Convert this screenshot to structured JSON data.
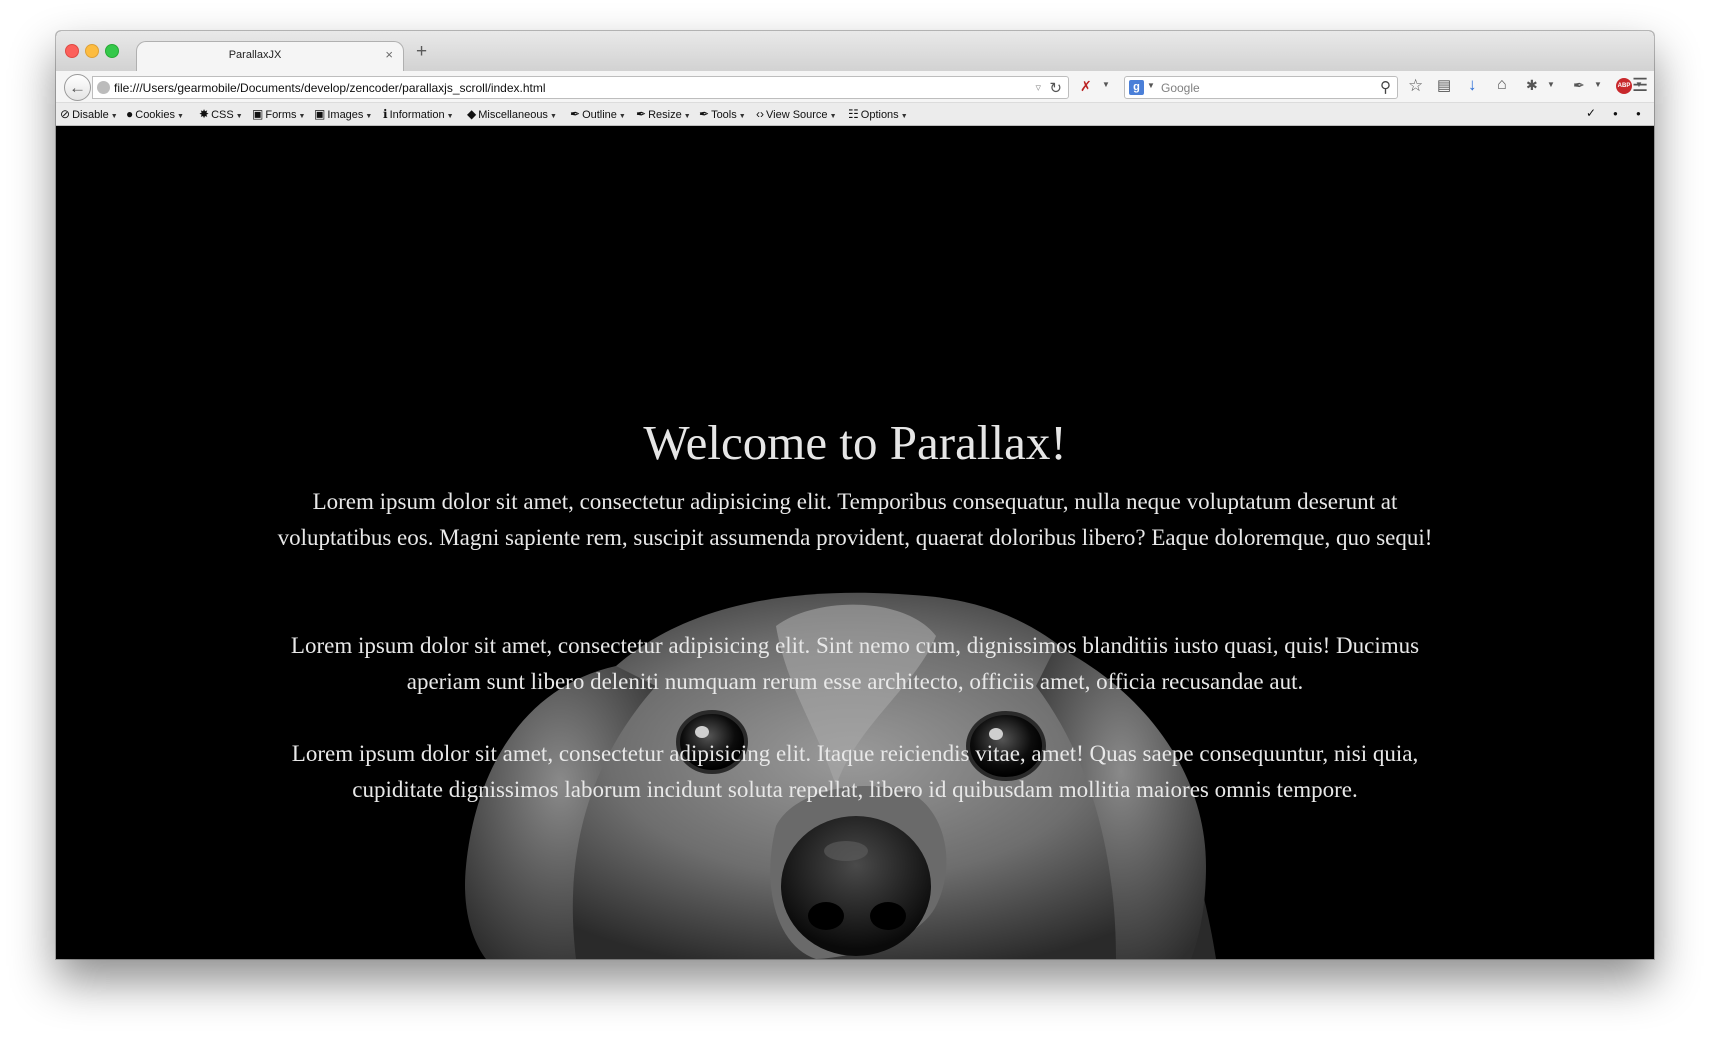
{
  "browser": {
    "tab_title": "ParallaxJX",
    "tab_close": "×",
    "new_tab": "+",
    "url": "file:///Users/gearmobile/Documents/develop/zencoder/parallaxjs_scroll/index.html",
    "search_engine": "Google",
    "search_placeholder": "Google"
  },
  "devbar": {
    "items": [
      {
        "label": "Disable",
        "icon": "disable-icon"
      },
      {
        "label": "Cookies",
        "icon": "cookies-icon"
      },
      {
        "label": "CSS",
        "icon": "css-icon"
      },
      {
        "label": "Forms",
        "icon": "forms-icon"
      },
      {
        "label": "Images",
        "icon": "images-icon"
      },
      {
        "label": "Information",
        "icon": "information-icon"
      },
      {
        "label": "Miscellaneous",
        "icon": "miscellaneous-icon"
      },
      {
        "label": "Outline",
        "icon": "outline-icon"
      },
      {
        "label": "Resize",
        "icon": "resize-icon"
      },
      {
        "label": "Tools",
        "icon": "tools-icon"
      },
      {
        "label": "View Source",
        "icon": "view-source-icon"
      },
      {
        "label": "Options",
        "icon": "options-icon"
      }
    ]
  },
  "page": {
    "heading": "Welcome to Parallax!",
    "paragraphs": [
      "Lorem ipsum dolor sit amet, consectetur adipisicing elit. Temporibus consequatur, nulla neque voluptatum deserunt at voluptatibus eos. Magni sapiente rem, suscipit assumenda provident, quaerat doloribus libero? Eaque doloremque, quo sequi!",
      "Lorem ipsum dolor sit amet, consectetur adipisicing elit. Sint nemo cum, dignissimos blanditiis iusto quasi, quis! Ducimus aperiam sunt libero deleniti numquam rerum esse architecto, officiis amet, officia recusandae aut.",
      "Lorem ipsum dolor sit amet, consectetur adipisicing elit. Itaque reiciendis vitae, amet! Quas saepe consequuntur, nisi quia, cupiditate dignissimos laborum incidunt soluta repellat, libero id quibusdam mollitia maiores omnis tempore."
    ]
  },
  "colors": {
    "page_background": "#000000",
    "text": "#e8e8e8",
    "close": "#fc605b",
    "minimize": "#fdbc40",
    "maximize": "#34c84a"
  }
}
